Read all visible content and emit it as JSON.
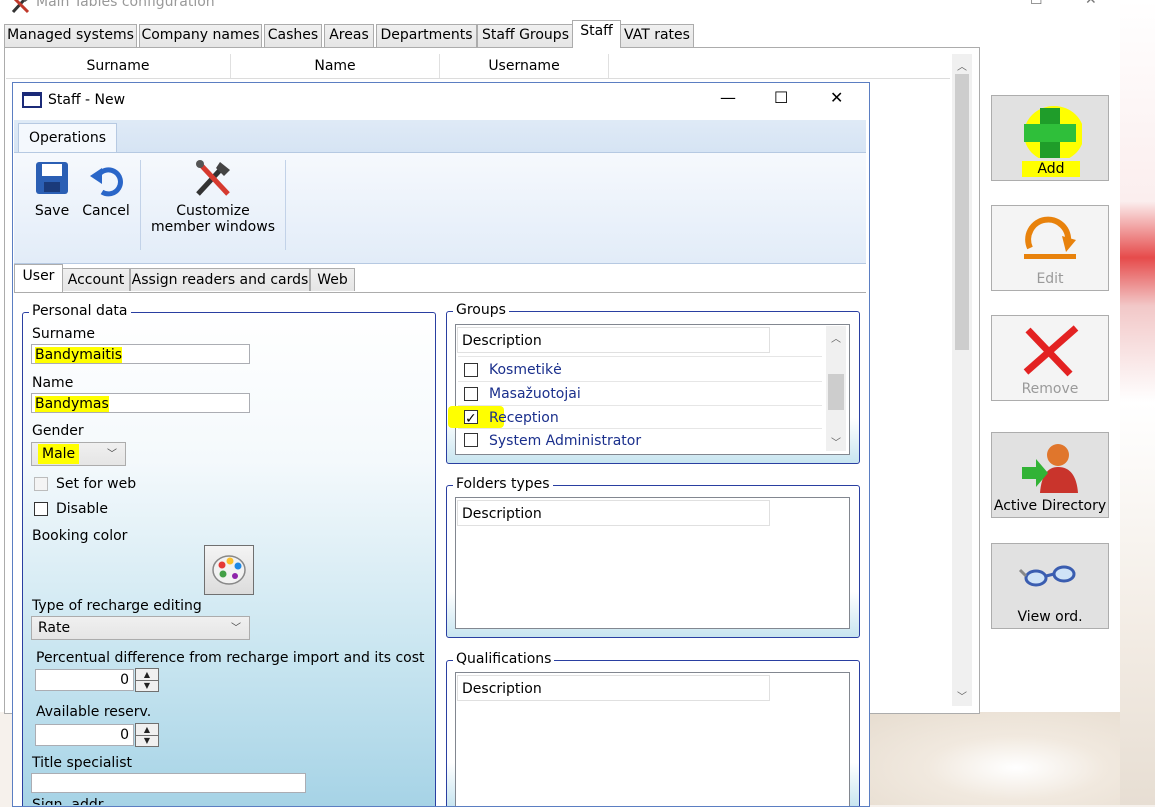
{
  "main_window": {
    "title": "Main Tables configuration",
    "tabs": [
      "Managed systems",
      "Company names",
      "Cashes",
      "Areas",
      "Departments",
      "Staff Groups",
      "Staff",
      "VAT rates"
    ],
    "active_tab": "Staff",
    "grid_columns": [
      "Surname",
      "Name",
      "Username"
    ],
    "side_buttons": {
      "add": "Add",
      "edit": "Edit",
      "remove": "Remove",
      "active_directory": "Active Directory",
      "view_ord": "View ord."
    }
  },
  "dialog": {
    "title": "Staff - New",
    "ribbon_tab": "Operations",
    "ribbon": {
      "save": "Save",
      "cancel": "Cancel",
      "customize_line1": "Customize",
      "customize_line2": "member windows"
    },
    "tabs": [
      "User",
      "Account",
      "Assign readers and cards",
      "Web"
    ],
    "active_tab": "User",
    "personal_data": {
      "legend": "Personal data",
      "surname_label": "Surname",
      "surname_value": "Bandymaitis",
      "name_label": "Name",
      "name_value": "Bandymas",
      "gender_label": "Gender",
      "gender_value": "Male",
      "set_for_web": "Set for web",
      "disable": "Disable",
      "booking_color": "Booking color",
      "recharge_label": "Type of recharge editing",
      "recharge_value": "Rate",
      "percentual_label": "Percentual difference from recharge import and its cost",
      "percentual_value": "0",
      "available_label": "Available reserv.",
      "available_value": "0",
      "title_specialist": "Title specialist",
      "sign_label": "Sign. addr."
    },
    "groups": {
      "legend": "Groups",
      "header": "Description",
      "items": [
        {
          "label": "Kosmetikė",
          "checked": false
        },
        {
          "label": "Masažuotojai",
          "checked": false
        },
        {
          "label": "Reception",
          "checked": true
        },
        {
          "label": "System Administrator",
          "checked": false
        }
      ]
    },
    "folders_types": {
      "legend": "Folders types",
      "header": "Description"
    },
    "qualifications": {
      "legend": "Qualifications",
      "header": "Description"
    }
  },
  "colors": {
    "highlight": "#ffff00",
    "group_border": "#2a3fa1",
    "dialog_border": "#5b7ec2"
  }
}
